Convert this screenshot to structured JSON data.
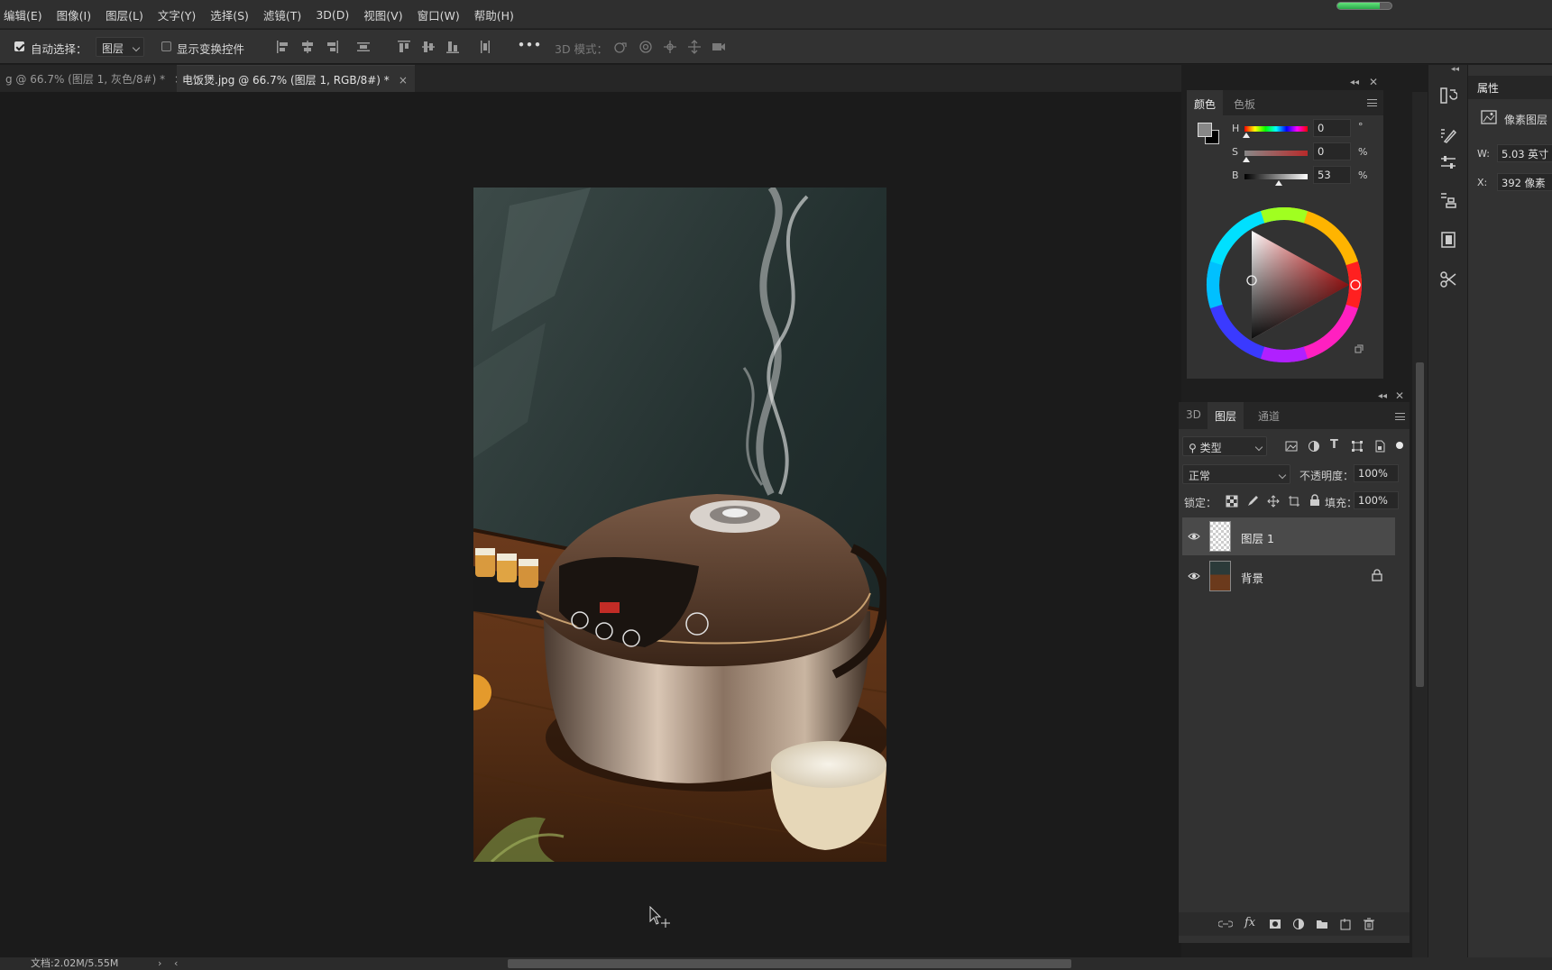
{
  "menu": [
    "编辑(E)",
    "图像(I)",
    "图层(L)",
    "文字(Y)",
    "选择(S)",
    "滤镜(T)",
    "3D(D)",
    "视图(V)",
    "窗口(W)",
    "帮助(H)"
  ],
  "options": {
    "auto_select_label": "自动选择：",
    "auto_select_value": "图层",
    "show_transform_label": "显示变换控件",
    "more_label": "•••",
    "mode_3d_label": "3D 模式："
  },
  "tabs": [
    {
      "label": "g @ 66.7% (图层 1, 灰色/8#) *",
      "close": "×"
    },
    {
      "label": "电饭煲.jpg @ 66.7% (图层 1, RGB/8#) *",
      "close": "×"
    }
  ],
  "color_panel": {
    "tabs": [
      "颜色",
      "色板"
    ],
    "h_label": "H",
    "h_value": "0",
    "h_unit": "°",
    "s_label": "S",
    "s_value": "0",
    "s_unit": "%",
    "b_label": "B",
    "b_value": "53",
    "b_unit": "%",
    "foreground": "#878787",
    "background": "#000000"
  },
  "layers_panel": {
    "tabs": [
      "3D",
      "图层",
      "通道"
    ],
    "filter_label": "类型",
    "blend_mode": "正常",
    "opacity_label": "不透明度：",
    "opacity_value": "100%",
    "lock_label": "锁定：",
    "fill_label": "填充：",
    "fill_value": "100%",
    "layers": [
      {
        "name": "图层 1",
        "selected": true,
        "locked": false
      },
      {
        "name": "背景",
        "selected": false,
        "locked": true
      }
    ]
  },
  "properties_panel": {
    "title": "属性",
    "layer_type": "像素图层",
    "w_label": "W:",
    "w_value": "5.03 英寸",
    "x_label": "X:",
    "x_value": "392 像素"
  },
  "status": {
    "doc_size": "文档:2.02M/5.55M"
  },
  "task_progress": 0.78
}
